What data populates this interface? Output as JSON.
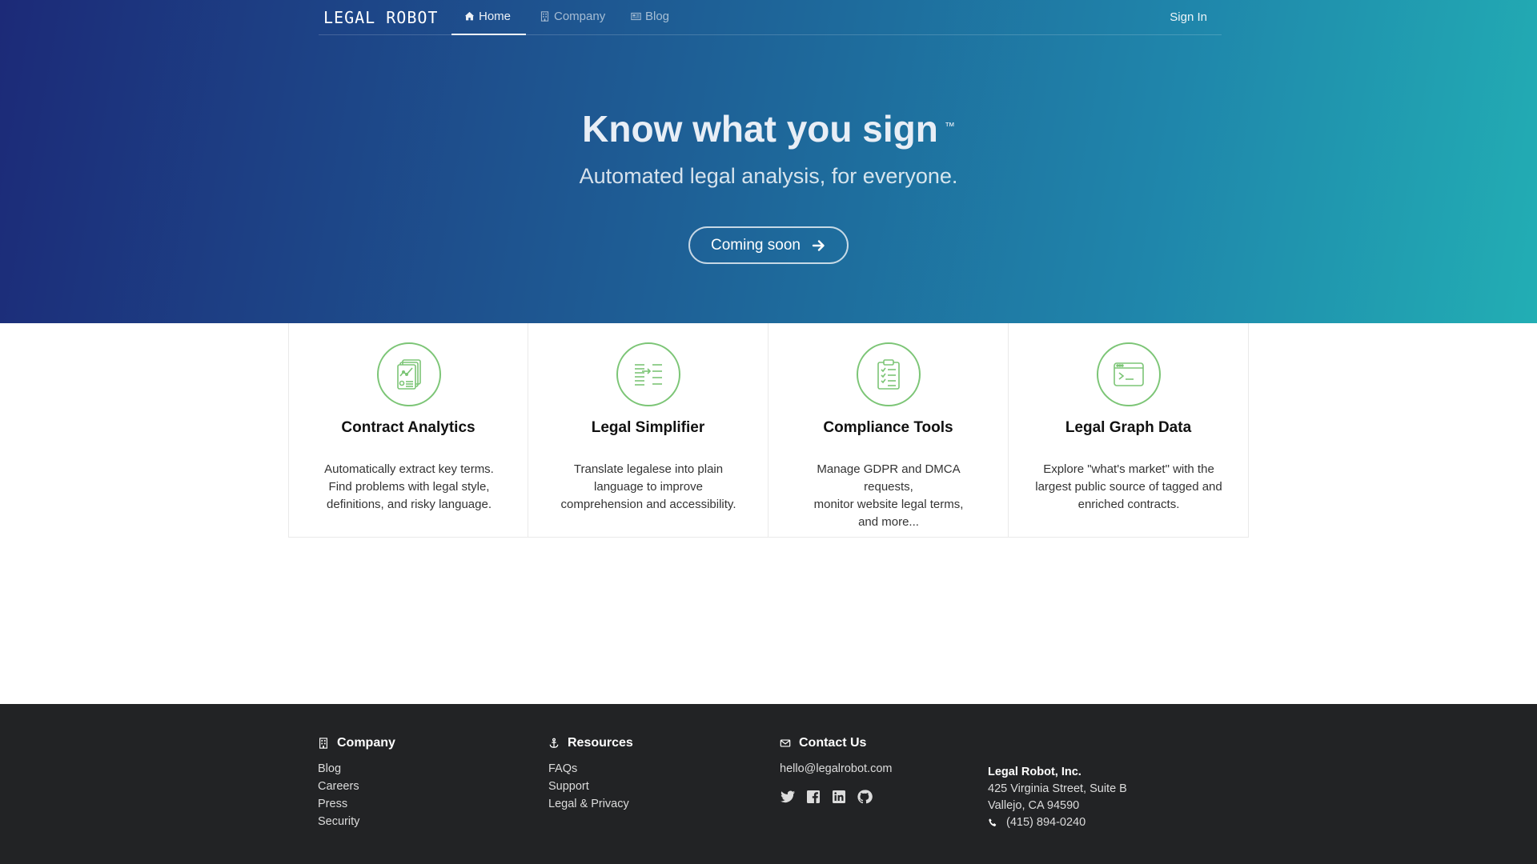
{
  "nav": {
    "logo": "LEGAL ROBOT",
    "home": "Home",
    "company": "Company",
    "blog": "Blog",
    "sign_in": "Sign In"
  },
  "hero": {
    "title": "Know what you sign",
    "trademark": "™",
    "subtitle": "Automated legal analysis, for everyone.",
    "cta": "Coming soon"
  },
  "features": [
    {
      "icon": "contract-analytics-icon",
      "title": "Contract Analytics",
      "line1": "Automatically extract key terms.",
      "line2": "Find problems with legal style,",
      "line3": "definitions, and risky language."
    },
    {
      "icon": "legal-simplifier-icon",
      "title": "Legal Simplifier",
      "line1": "Translate legalese into plain",
      "line2": "language to improve",
      "line3": "comprehension and accessibility."
    },
    {
      "icon": "compliance-checklist-icon",
      "title": "Compliance Tools",
      "line1": "Manage GDPR and DMCA requests,",
      "line2": "monitor website legal terms,",
      "line3": "and more..."
    },
    {
      "icon": "terminal-window-icon",
      "title": "Legal Graph Data",
      "line1": "Explore \"what's market\" with the",
      "line2": "largest public source of tagged and",
      "line3": "enriched contracts."
    }
  ],
  "footer": {
    "company": {
      "heading": "Company",
      "links": [
        "Blog",
        "Careers",
        "Press",
        "Security"
      ]
    },
    "resources": {
      "heading": "Resources",
      "links": [
        "FAQs",
        "Support",
        "Legal & Privacy"
      ]
    },
    "contact": {
      "heading": "Contact Us",
      "email": "hello@legalrobot.com",
      "social": [
        "twitter-icon",
        "facebook-icon",
        "linkedin-icon",
        "github-icon"
      ]
    },
    "address": {
      "name": "Legal Robot, Inc.",
      "street": "425 Virginia Street, Suite B",
      "city": "Vallejo, CA 94590",
      "phone": "(415) 894-0240"
    }
  },
  "colors": {
    "accent_green": "#7cc576",
    "hero_start": "#1c2a78",
    "hero_end": "#22aeb4",
    "footer_bg": "#222325"
  }
}
